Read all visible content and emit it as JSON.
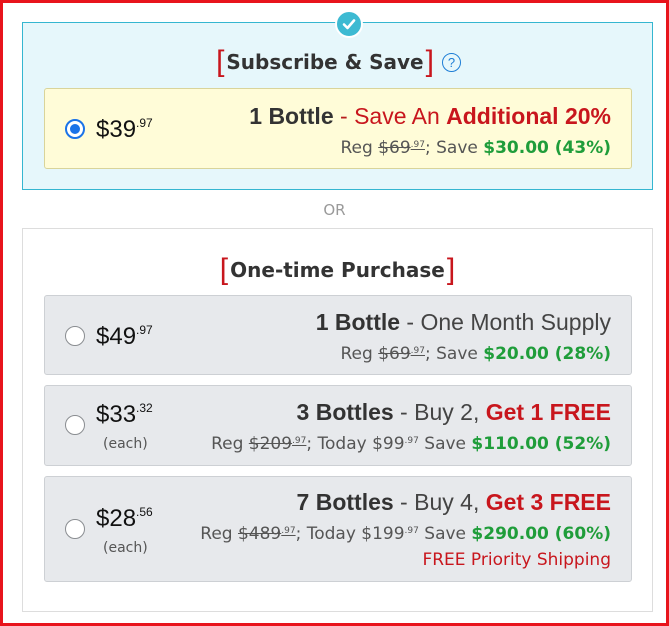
{
  "colors": {
    "frame_border": "#e8141c",
    "subscribe_bg": "#e6f7fb",
    "subscribe_border": "#35b6d0",
    "highlight_bg": "#fffcd8",
    "option_bg": "#e7e9ec",
    "accent_red": "#c8161d",
    "save_green": "#1f9d3a",
    "radio_blue": "#1a73e8"
  },
  "subscribe": {
    "badge_icon": "check-icon",
    "title": "Subscribe & Save",
    "help_icon": "question-icon",
    "help_glyph": "?",
    "option": {
      "selected": true,
      "price_main": "$39",
      "price_cents": ".97",
      "qty": "1 Bottle",
      "sep": " - ",
      "desc_plain": "Save An ",
      "desc_bold": "Additional 20%",
      "reg_label": "Reg ",
      "reg_main": "$69",
      "reg_cents": ".97",
      "save_label": "; Save ",
      "save_value": "$30.00 (43%)"
    }
  },
  "or_label": "OR",
  "one_time": {
    "title": "One-time Purchase",
    "options": [
      {
        "selected": false,
        "price_main": "$49",
        "price_cents": ".97",
        "qty": "1 Bottle",
        "sep": " - ",
        "desc": "One Month Supply",
        "reg_label": "Reg ",
        "reg_main": "$69",
        "reg_cents": ".97",
        "save_label": "; Save ",
        "save_value": "$20.00 (28%)"
      },
      {
        "selected": false,
        "price_main": "$33",
        "price_cents": ".32",
        "each": "(each)",
        "qty": "3 Bottles",
        "sep": " - ",
        "desc": "Buy 2, ",
        "promo": "Get 1 FREE",
        "reg_label": "Reg ",
        "reg_main": "$209",
        "reg_cents": ".97",
        "today_label": "; Today ",
        "today_main": "$99",
        "today_cents": ".97",
        "save_label": " Save ",
        "save_value": "$110.00 (52%)"
      },
      {
        "selected": false,
        "price_main": "$28",
        "price_cents": ".56",
        "each": "(each)",
        "qty": "7 Bottles",
        "sep": " - ",
        "desc": "Buy 4, ",
        "promo": "Get 3 FREE",
        "reg_label": "Reg ",
        "reg_main": "$489",
        "reg_cents": ".97",
        "today_label": "; Today ",
        "today_main": "$199",
        "today_cents": ".97",
        "save_label": " Save ",
        "save_value": "$290.00 (60%)",
        "shipping": "FREE Priority Shipping"
      }
    ]
  }
}
